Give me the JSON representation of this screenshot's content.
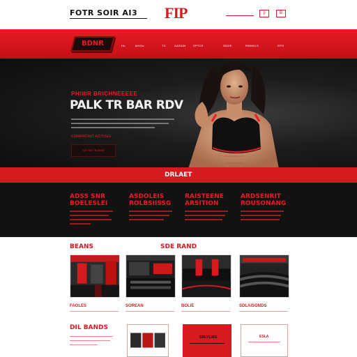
{
  "topbar": {
    "left_text": "FOTR SOIR AI3",
    "logo": "FIP",
    "right_box_1": "p",
    "right_box_2": "B"
  },
  "nav": {
    "logo": "BDNR",
    "items": [
      "Ho",
      "MHOo",
      "TC",
      "AASAIN",
      "SPTCE",
      "SDOE",
      "RWNNLS",
      "EPO"
    ]
  },
  "hero": {
    "kicker": "PHIIIIR BRICHNEEEEE",
    "title": "PALK TR BAR RDV",
    "subtitle": "ESBAPAIONIT AIOTVIES",
    "button": "SAT BNT BODNE"
  },
  "band": {
    "label": "DRLAET"
  },
  "features": [
    {
      "title": "ADSS SNR\nBOELESLEI"
    },
    {
      "title": "ASDOLEIS\nROLBSIISSG"
    },
    {
      "title": "RAISTEENE\nARSITION"
    },
    {
      "title": "ARDSENRIT\nROUSONANG"
    }
  ],
  "sections": {
    "left_title": "BEANS",
    "center_title": "SDE RAND",
    "bottom_title": "DIL BANDS"
  },
  "gallery": {
    "captions": [
      "FAOLES",
      "SOREAN",
      "BOLIE",
      "SDLAISONDS"
    ]
  },
  "bottom_cards": [
    "SRUTLIRG",
    "ESLA"
  ],
  "colors": {
    "accent": "#d71920",
    "dark": "#121212",
    "hero": "#1c1c1c"
  }
}
